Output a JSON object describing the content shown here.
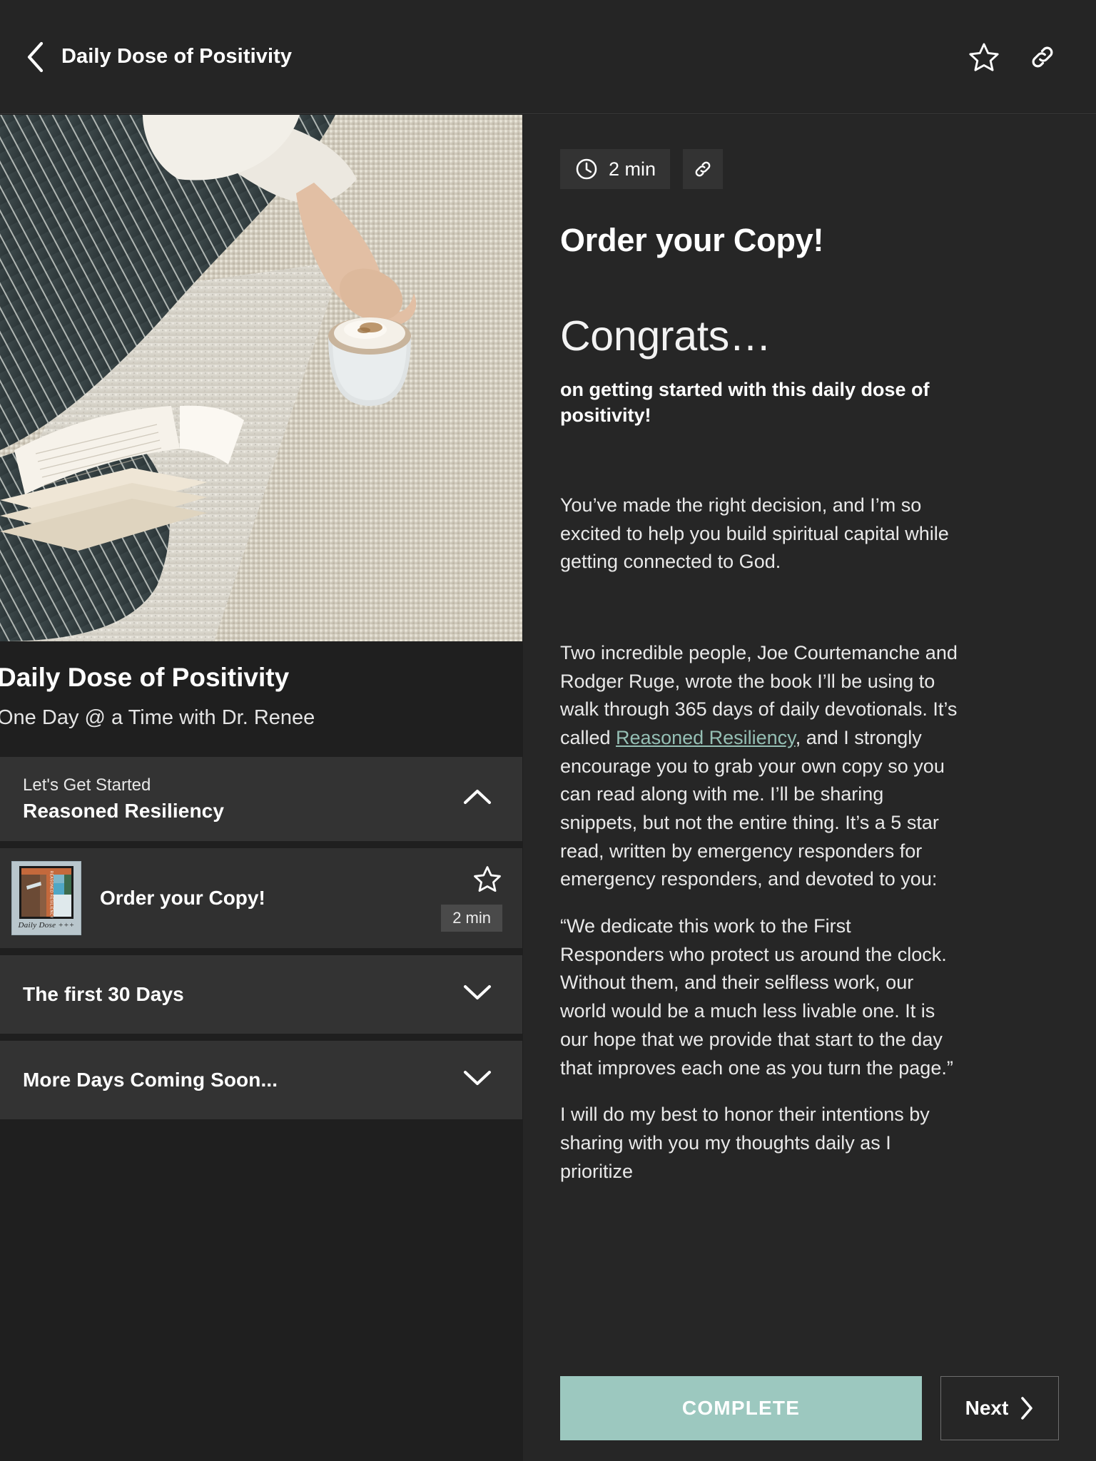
{
  "topbar": {
    "back_icon": "chevron-left-icon",
    "title": "Daily Dose of Positivity",
    "favorite_icon": "star-outline-icon",
    "link_icon": "link-icon"
  },
  "course": {
    "hero_image_alt": "person in striped pajamas reading a book beside a latte on a knit rug",
    "title": "Daily Dose of Positivity",
    "subtitle": "One Day @ a Time with Dr. Renee"
  },
  "curriculum": [
    {
      "kicker": "Let's Get Started",
      "title": "Reasoned Resiliency",
      "chevron": "chevron-up-icon",
      "expanded": true,
      "lessons": [
        {
          "title": "Order your Copy!",
          "duration": "2 min",
          "favorite_icon": "star-outline-icon",
          "thumbnail_caption": "Daily Dose +++",
          "thumbnail_cover_text": "REASONED RESILIENCY"
        }
      ]
    },
    {
      "kicker": "",
      "title": "The first 30 Days",
      "chevron": "chevron-down-icon",
      "expanded": false,
      "lessons": []
    },
    {
      "kicker": "",
      "title": "More Days Coming Soon...",
      "chevron": "chevron-down-icon",
      "expanded": false,
      "lessons": []
    }
  ],
  "lesson": {
    "duration": "2 min",
    "clock_icon": "clock-icon",
    "link_icon": "link-icon",
    "heading": "Order your Copy!",
    "congrats": "Congrats…",
    "lead": "on getting started with this daily dose of positivity!",
    "paragraph_1": "You’ve made the right decision, and I’m so excited to help you build spiritual capital while getting connected to God.",
    "paragraph_2_before_link": "Two incredible people, Joe Courtemanche and Rodger Ruge, wrote the book I’ll be using to walk through 365 days of daily devotionals. It’s called ",
    "paragraph_2_link": "Reasoned Resiliency",
    "paragraph_2_after_link": ", and I strongly encourage you to grab your own copy so you can read along with me. I’ll be sharing snippets, but not the entire thing. It’s a 5 star read, written by emergency responders for emergency responders, and devoted to you:",
    "paragraph_3": "“We dedicate this work to the First Responders who protect us around the clock. Without them, and their selfless work, our world would be a much less livable one. It is our hope that we provide that start to the day that improves each one as you turn the page.”",
    "paragraph_4": "I will do my best to honor their intentions by sharing with you my thoughts daily as I prioritize"
  },
  "footer": {
    "complete_label": "COMPLETE",
    "next_label": "Next",
    "next_icon": "chevron-right-icon"
  },
  "colors": {
    "page_background": "#1f1f1f",
    "panel_background": "#262626",
    "card_background": "#333333",
    "accent_complete": "#9cc8bf",
    "link": "#95bfb4",
    "text_primary": "#ffffff"
  }
}
